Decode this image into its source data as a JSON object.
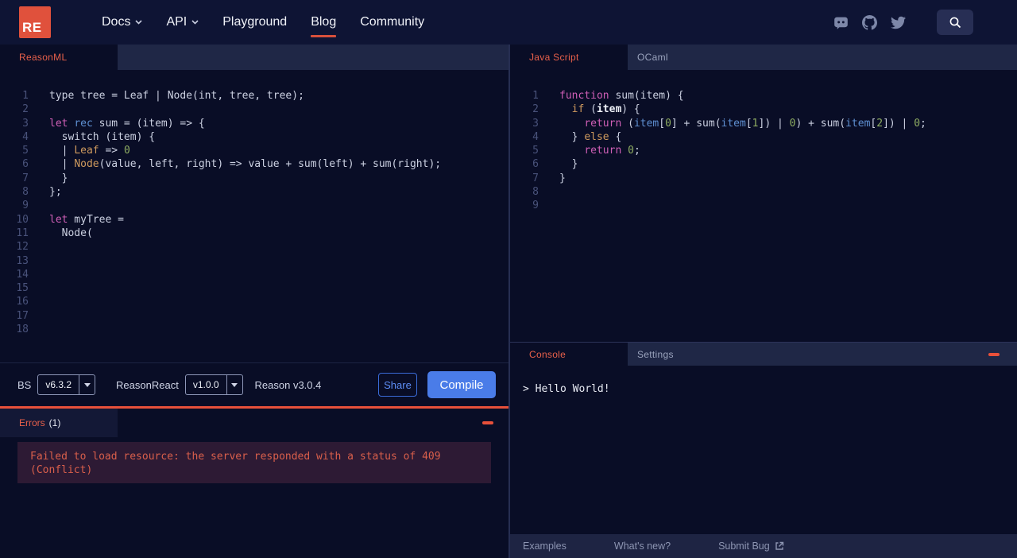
{
  "navbar": {
    "logo_text": "RE",
    "items": [
      {
        "label": "Docs"
      },
      {
        "label": "API"
      },
      {
        "label": "Playground"
      },
      {
        "label": "Blog"
      },
      {
        "label": "Community"
      }
    ]
  },
  "left_pane": {
    "tab_label": "ReasonML",
    "editor": {
      "lines": [
        [
          [
            "fg",
            "type tree = Leaf | Node(int, tree, tree);"
          ]
        ],
        [],
        [
          [
            "kw",
            "let"
          ],
          [
            "fg",
            " "
          ],
          [
            "kw3",
            "rec"
          ],
          [
            "fg",
            " sum = (item) => {"
          ]
        ],
        [
          [
            "fg",
            "  switch (item) {"
          ]
        ],
        [
          [
            "fg",
            "  | "
          ],
          [
            "kw2",
            "Leaf"
          ],
          [
            "fg",
            " => "
          ],
          [
            "num",
            "0"
          ]
        ],
        [
          [
            "fg",
            "  | "
          ],
          [
            "kw2",
            "Node"
          ],
          [
            "fg",
            "(value, left, right) => value + sum(left) + sum(right);"
          ]
        ],
        [
          [
            "fg",
            "  }"
          ]
        ],
        [
          [
            "fg",
            "};"
          ]
        ],
        [],
        [
          [
            "kw",
            "let"
          ],
          [
            "fg",
            " myTree ="
          ]
        ],
        [
          [
            "fg",
            "  Node("
          ]
        ],
        [],
        [],
        [],
        [],
        [],
        [],
        []
      ]
    },
    "toolbar": {
      "bs_label": "BS",
      "bs_version": "v6.3.2",
      "reasonreact_label": "ReasonReact",
      "reasonreact_version": "v1.0.0",
      "reason_version": "Reason v3.0.4",
      "share_label": "Share",
      "compile_label": "Compile"
    },
    "errors": {
      "title": "Errors",
      "count": "(1)",
      "message": "Failed to load resource: the server responded with a status of 409 (Conflict)"
    }
  },
  "right_pane": {
    "tabs": {
      "active_label": "Java Script",
      "secondary_label": "OCaml"
    },
    "editor": {
      "lines": [
        [
          [
            "kw",
            "function"
          ],
          [
            "fg",
            " sum(item) {"
          ]
        ],
        [
          [
            "fg",
            "  "
          ],
          [
            "kw2",
            "if"
          ],
          [
            "fg",
            " ("
          ],
          [
            "bold",
            "item"
          ],
          [
            "fg",
            ") {"
          ]
        ],
        [
          [
            "fg",
            "    "
          ],
          [
            "kw",
            "return"
          ],
          [
            "fg",
            " ("
          ],
          [
            "kw3",
            "item"
          ],
          [
            "fg",
            "["
          ],
          [
            "num",
            "0"
          ],
          [
            "fg",
            "] + sum("
          ],
          [
            "kw3",
            "item"
          ],
          [
            "fg",
            "["
          ],
          [
            "num",
            "1"
          ],
          [
            "fg",
            "]) | "
          ],
          [
            "num",
            "0"
          ],
          [
            "fg",
            ") + sum("
          ],
          [
            "kw3",
            "item"
          ],
          [
            "fg",
            "["
          ],
          [
            "num",
            "2"
          ],
          [
            "fg",
            "]) | "
          ],
          [
            "num",
            "0"
          ],
          [
            "fg",
            ";"
          ]
        ],
        [
          [
            "fg",
            "  } "
          ],
          [
            "kw2",
            "else"
          ],
          [
            "fg",
            " {"
          ]
        ],
        [
          [
            "fg",
            "    "
          ],
          [
            "kw",
            "return"
          ],
          [
            "fg",
            " "
          ],
          [
            "num",
            "0"
          ],
          [
            "fg",
            ";"
          ]
        ],
        [
          [
            "fg",
            "  }"
          ]
        ],
        [
          [
            "fg",
            "}"
          ]
        ],
        [],
        []
      ]
    },
    "console": {
      "active_tab_label": "Console",
      "secondary_tab_label": "Settings",
      "output": "> Hello World!"
    },
    "footer": {
      "examples_label": "Examples",
      "whats_new_label": "What's new?",
      "submit_bug_label": "Submit Bug"
    }
  },
  "colors": {
    "accent_red": "#e0513c",
    "active_tab_red": "#e8604a",
    "primary_blue": "#4a7ce8",
    "error_text": "#d95f4b",
    "background": "#090d26",
    "tabbar_background": "#1f2746"
  }
}
